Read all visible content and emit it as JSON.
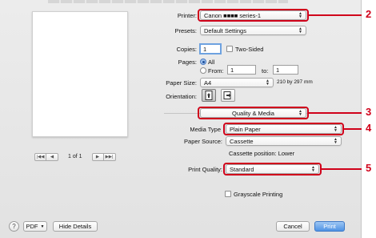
{
  "printer": {
    "label": "Printer:",
    "value": "Canon ■■■■ series-1"
  },
  "presets": {
    "label": "Presets:",
    "value": "Default Settings"
  },
  "copies": {
    "label": "Copies:",
    "value": "1",
    "two_sided_label": "Two-Sided",
    "two_sided": false
  },
  "pages": {
    "label": "Pages:",
    "all_label": "All",
    "from_label": "From:",
    "from_value": "1",
    "to_label": "to:",
    "to_value": "1"
  },
  "paper_size": {
    "label": "Paper Size:",
    "value": "A4",
    "dimensions": "210 by 297 mm"
  },
  "orientation": {
    "label": "Orientation:"
  },
  "panel": {
    "value": "Quality & Media"
  },
  "media_type": {
    "label": "Media Type",
    "value": "Plain Paper"
  },
  "paper_source": {
    "label": "Paper Source:",
    "value": "Cassette"
  },
  "cassette_position": "Cassette position: Lower",
  "print_quality": {
    "label": "Print Quality:",
    "value": "Standard"
  },
  "grayscale": {
    "label": "Grayscale Printing",
    "checked": false
  },
  "pager": {
    "text": "1 of 1"
  },
  "buttons": {
    "help": "?",
    "pdf": "PDF",
    "hide_details": "Hide Details",
    "cancel": "Cancel",
    "print": "Print"
  },
  "callouts": [
    "2",
    "3",
    "4",
    "5"
  ],
  "colors": {
    "callout": "#d0021b",
    "accent": "#4f93e4"
  }
}
